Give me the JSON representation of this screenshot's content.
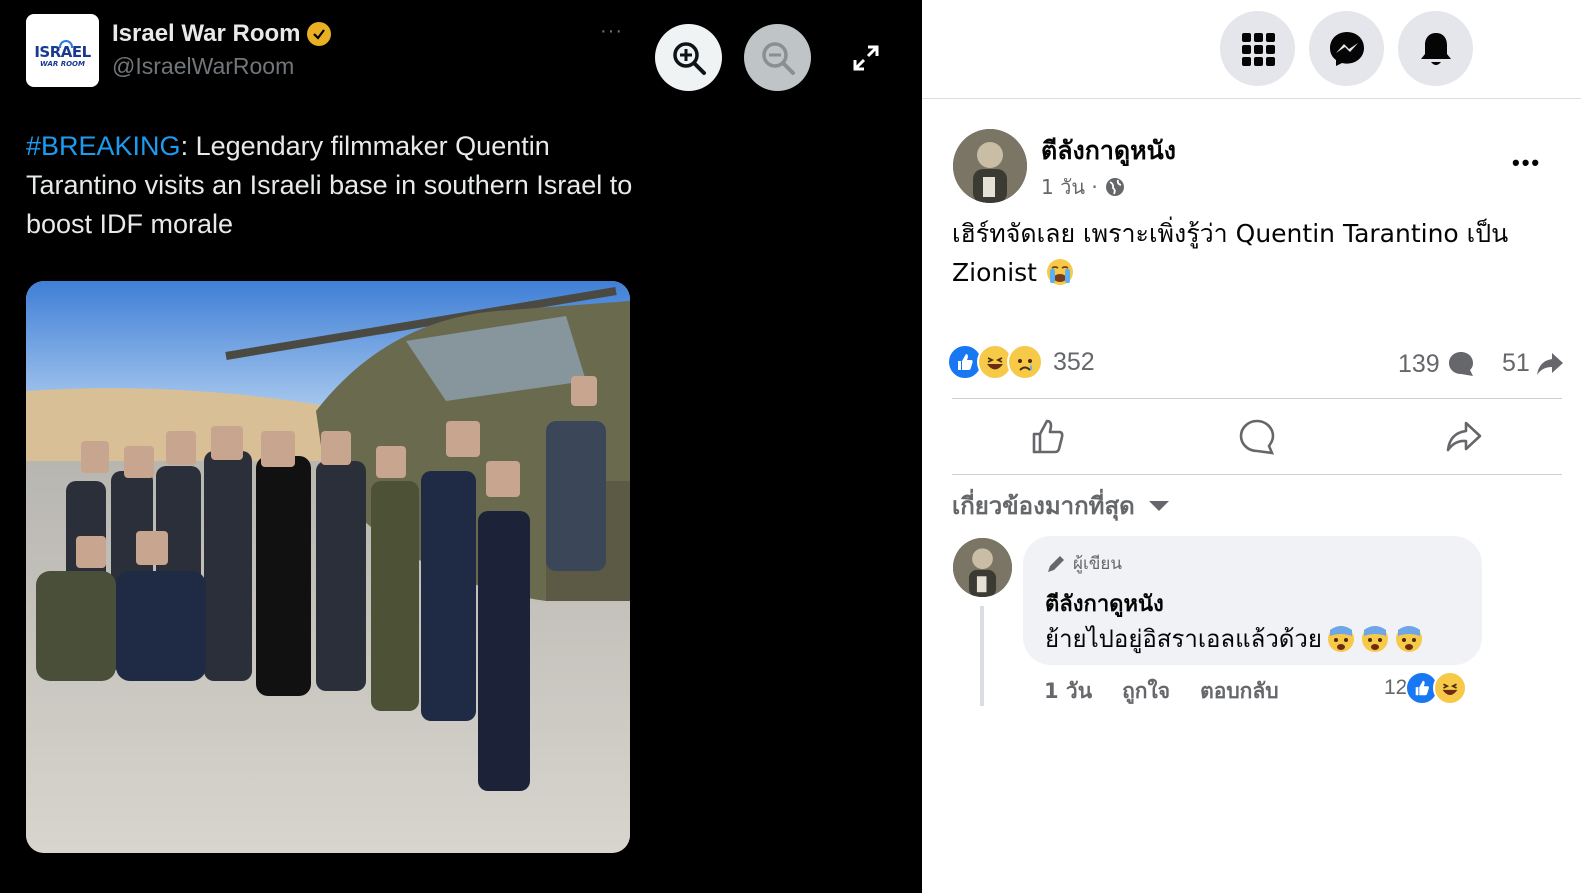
{
  "tweet": {
    "avatar_line1": "ISRAEL",
    "avatar_line2": "WAR ROOM",
    "author_name": "Israel War Room",
    "handle": "@IsraelWarRoom",
    "more_label": "···",
    "hashtag": "#BREAKING",
    "body": ": Legendary filmmaker Quentin Tarantino visits an Israeli base in southern Israel to boost IDF morale",
    "verified_color": "#e8b022",
    "hashtag_color": "#1d9bf0",
    "icons": [
      "zoom-in-icon",
      "zoom-out-icon",
      "expand-icon",
      "verified-badge-icon"
    ]
  },
  "facebook": {
    "topbar_icons": [
      "apps-grid-icon",
      "messenger-icon",
      "notifications-bell-icon"
    ],
    "page_name": "ตีลังกาดูหนัง",
    "post_time": "1 วัน ·",
    "more_label": "•••",
    "post_text": "เฮิร์ทจัดเลย เพราะเพิ่งรู้ว่า Quentin Tarantino เป็น Zionist",
    "reaction_count": "352",
    "comment_count": "139",
    "share_count": "51",
    "sort_label": "เกี่ยวข้องมากที่สุด",
    "comment": {
      "author_badge": "ผู้เขียน",
      "author_name": "ตีลังกาดูหนัง",
      "text": "ย้ายไปอยู่อิสราเอลแล้วด้วย",
      "time": "1 วัน",
      "like_label": "ถูกใจ",
      "reply_label": "ตอบกลับ",
      "reaction_count": "12"
    },
    "accent_color": "#1877f2"
  }
}
